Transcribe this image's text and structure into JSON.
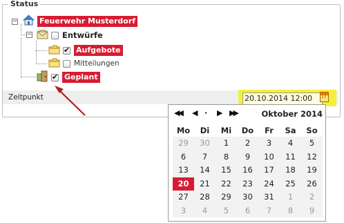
{
  "status": {
    "legend": "Status",
    "tree": {
      "root": {
        "label": "Feuerwehr Musterdorf",
        "expander": "−"
      },
      "entwuerfe": {
        "label": "Entwürfe",
        "expander": "−",
        "checked": false
      },
      "aufgebote": {
        "label": "Aufgebote",
        "checked": true
      },
      "mitteilungen": {
        "label": "Mitteilungen",
        "checked": false
      },
      "geplant": {
        "label": "Geplant",
        "checked": true
      }
    }
  },
  "zeitpunkt": {
    "label": "Zeitpunkt",
    "value": "20.10.2014 12:00",
    "calendar_button_icon": "calendar-icon",
    "calendar_button_text": "17"
  },
  "calendar": {
    "nav": {
      "prev_year": "◀◀",
      "prev_month": "◀",
      "today": "·",
      "next_month": "▶",
      "next_year": "▶▶"
    },
    "month_title": "Oktober 2014",
    "weekdays": [
      "Mo",
      "Di",
      "Mi",
      "Do",
      "Fr",
      "Sa",
      "So"
    ],
    "weeks": [
      [
        "29",
        "30",
        "1",
        "2",
        "3",
        "4",
        "5"
      ],
      [
        "6",
        "7",
        "8",
        "9",
        "10",
        "11",
        "12"
      ],
      [
        "13",
        "14",
        "15",
        "16",
        "17",
        "18",
        "19"
      ],
      [
        "20",
        "21",
        "22",
        "23",
        "24",
        "25",
        "26"
      ],
      [
        "27",
        "28",
        "29",
        "30",
        "31",
        "1",
        "2"
      ],
      [
        "3",
        "4",
        "5",
        "6",
        "7",
        "8",
        "9"
      ]
    ],
    "selected_day": "20",
    "accent_color": "#d81b32",
    "highlight_color": "#f4ef3a"
  }
}
